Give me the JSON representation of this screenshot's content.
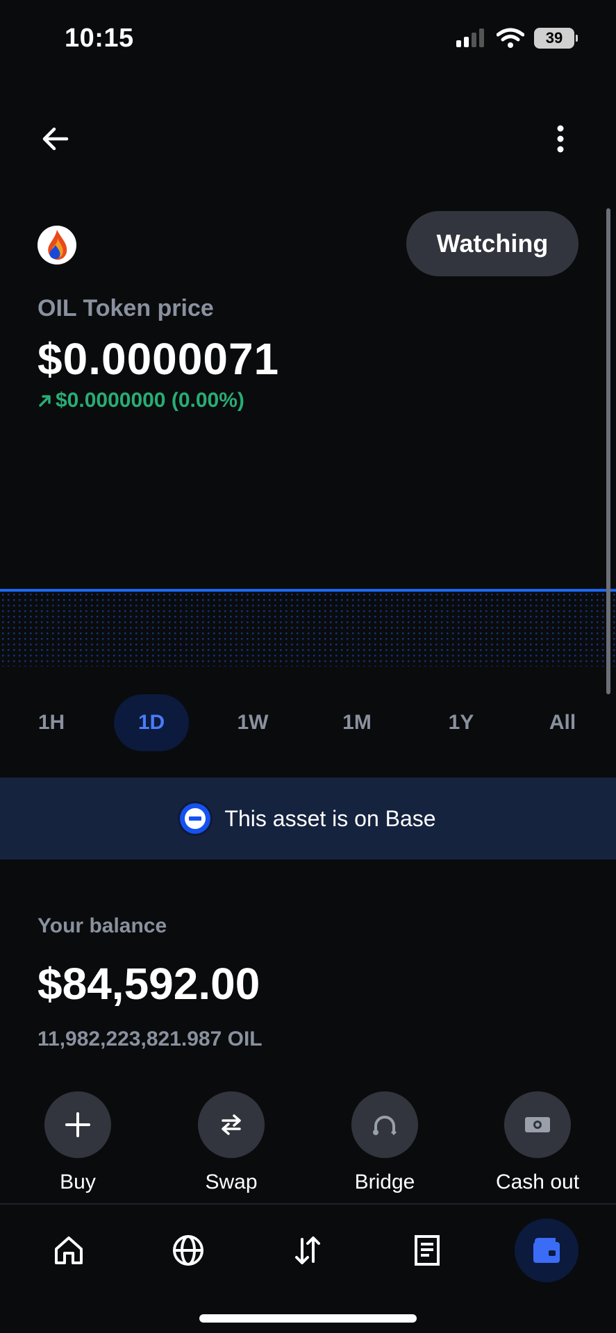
{
  "status_bar": {
    "time": "10:15",
    "battery": "39"
  },
  "header": {
    "back_icon": "arrow-left-icon",
    "more_icon": "more-vertical-icon"
  },
  "token": {
    "logo_icon": "oil-drop-icon",
    "watch_label": "Watching",
    "price_label": "OIL Token price",
    "price": "$0.0000071",
    "change_icon": "arrow-up-right-icon",
    "change": "$0.0000000 (0.00%)",
    "change_color": "#27ad75"
  },
  "chart_data": {
    "type": "line",
    "title": "",
    "xlabel": "",
    "ylabel": "",
    "x": [
      0,
      1
    ],
    "series": [
      {
        "values": [
          7.1e-06,
          7.1e-06
        ]
      }
    ],
    "ylim": [
      6.6e-06,
      7.2e-06
    ],
    "grid": false,
    "line_color": "#1e6bff"
  },
  "ranges": [
    {
      "label": "1H",
      "active": false
    },
    {
      "label": "1D",
      "active": true
    },
    {
      "label": "1W",
      "active": false
    },
    {
      "label": "1M",
      "active": false
    },
    {
      "label": "1Y",
      "active": false
    },
    {
      "label": "All",
      "active": false
    }
  ],
  "network_banner": {
    "icon": "base-network-icon",
    "text": "This asset is on Base"
  },
  "balance": {
    "label": "Your balance",
    "value": "$84,592.00",
    "amount": "11,982,223,821.987 OIL"
  },
  "actions": [
    {
      "label": "Buy",
      "icon": "plus-icon"
    },
    {
      "label": "Swap",
      "icon": "swap-icon"
    },
    {
      "label": "Bridge",
      "icon": "bridge-icon"
    },
    {
      "label": "Cash out",
      "icon": "cash-icon"
    }
  ],
  "bottom_nav": [
    {
      "icon": "home-icon",
      "active": false
    },
    {
      "icon": "globe-icon",
      "active": false
    },
    {
      "icon": "transfer-icon",
      "active": false
    },
    {
      "icon": "document-icon",
      "active": false
    },
    {
      "icon": "wallet-icon",
      "active": true
    }
  ],
  "colors": {
    "accent": "#1652f0",
    "background": "#0a0b0d",
    "positive": "#27ad75"
  }
}
